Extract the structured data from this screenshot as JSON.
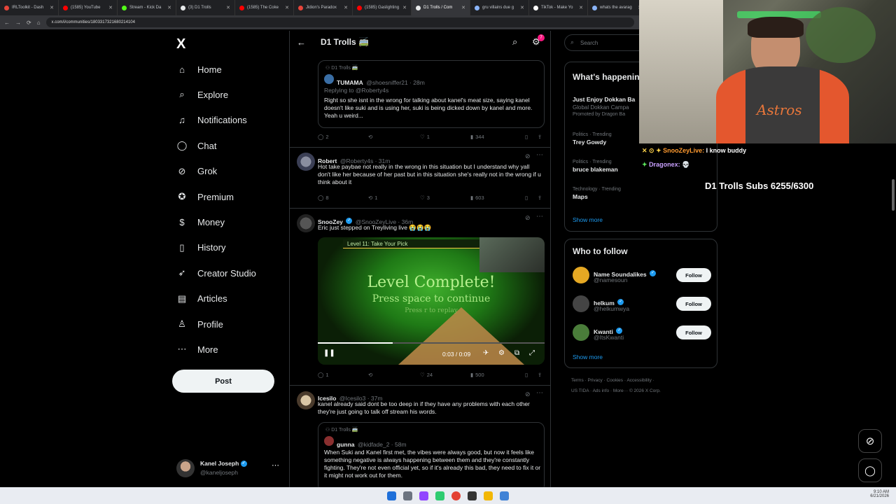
{
  "browser": {
    "tabs": [
      {
        "label": "IRLToolkit - Dash",
        "color": "#e6453a"
      },
      {
        "label": "(1585) YouTube",
        "color": "#ff0000"
      },
      {
        "label": "Stream - Kick Da",
        "color": "#53fc18"
      },
      {
        "label": "(3) D1 Trolls",
        "color": "#e7e9ea"
      },
      {
        "label": "(1585) The Coke",
        "color": "#ff0000"
      },
      {
        "label": "Jidion's Paradox",
        "color": "#e6453a"
      },
      {
        "label": "(1585) Gaslighting",
        "color": "#ff0000"
      },
      {
        "label": "D1 Trolls / Com",
        "color": "#e7e9ea",
        "active": true
      },
      {
        "label": "gru villains due g",
        "color": "#8ab4f8"
      },
      {
        "label": "TikTok - Make Yo",
        "color": "#ffffff"
      },
      {
        "label": "whats the avarag",
        "color": "#8ab4f8"
      }
    ],
    "url": "x.com/i/communities/1803317321680214104"
  },
  "nav": {
    "logo": "X",
    "items": [
      {
        "label": "Home",
        "icon": "home-icon",
        "glyph": "⌂"
      },
      {
        "label": "Explore",
        "icon": "search-icon",
        "glyph": "⌕"
      },
      {
        "label": "Notifications",
        "icon": "bell-icon",
        "glyph": "♫"
      },
      {
        "label": "Chat",
        "icon": "chat-icon",
        "glyph": "◯"
      },
      {
        "label": "Grok",
        "icon": "grok-icon",
        "glyph": "⊘"
      },
      {
        "label": "Premium",
        "icon": "premium-icon",
        "glyph": "✪"
      },
      {
        "label": "Money",
        "icon": "money-icon",
        "glyph": "$"
      },
      {
        "label": "History",
        "icon": "bookmark-icon",
        "glyph": "▯"
      },
      {
        "label": "Creator Studio",
        "icon": "rocket-icon",
        "glyph": "➶"
      },
      {
        "label": "Articles",
        "icon": "articles-icon",
        "glyph": "▤"
      },
      {
        "label": "Profile",
        "icon": "profile-icon",
        "glyph": "♙"
      },
      {
        "label": "More",
        "icon": "more-icon",
        "glyph": "⋯"
      }
    ],
    "post": "Post",
    "account": {
      "name": "Kanel Joseph",
      "handle": "@kaneljoseph"
    }
  },
  "header": {
    "title": "D1 Trolls 🚎",
    "badge": "7"
  },
  "feed": {
    "quote1": {
      "community": "D1 Trolls 🚎",
      "name": "TUMAMA",
      "meta": "@shoesniffer21 · 28m",
      "reply": "Replying to @Roberty4s",
      "text": "Right so she isnt in the wrong for talking about kanel's meat size, saying kanel doesn't like suki and is using her, suki is being dicked down by kanel and more. Yeah u weird..."
    },
    "actions1": {
      "replies": "2",
      "reposts": "",
      "likes": "1",
      "views": "344"
    },
    "post2": {
      "name": "Robert",
      "meta": "@Roberty4s · 31m",
      "text": "Hot take paybae not really in the wrong in this situation but I understand why yall don't like her because of her past but in this situation she's really not in the wrong if u think about it"
    },
    "actions2": {
      "replies": "8",
      "reposts": "1",
      "likes": "3",
      "views": "603"
    },
    "post3": {
      "name": "SnooZey",
      "meta": "@SnooZeyLive · 36m",
      "text": "Eric just stepped on Treyliving live 😭😭😭"
    },
    "video": {
      "level_bar": "Level 11: Take Your Pick",
      "complete": "Level Complete!",
      "press_space": "Press space to continue",
      "press_r": "Press r to replay",
      "time": "0:03 / 0:09"
    },
    "actions3": {
      "replies": "1",
      "reposts": "",
      "likes": "24",
      "views": "500"
    },
    "post4": {
      "name": "Icesilo",
      "meta": "@Icesilo3 · 37m",
      "text": "kanel already said dont be too deep in if they have any problems with each other they're just going to talk off stream his words."
    },
    "quote2": {
      "community": "D1 Trolls 🚎",
      "name": "gunna",
      "meta": "@kidfade_2 · 58m",
      "text": "When Suki and Kanel first met, the vibes were always good, but now it feels like something negative is always happening between them and they're constantly fighting. They're not even official yet, so if it's already this bad, they need to fix it or it might not work out for them."
    }
  },
  "right": {
    "search_placeholder": "Search",
    "happening_title": "What's happening",
    "ad": {
      "title": "Just Enjoy Dokkan Ba",
      "sub": "Global Dokkan Campa",
      "promo": "Promoted by Dragon Ba"
    },
    "trends": [
      {
        "cat": "Politics · Trending",
        "name": "Trey Gowdy"
      },
      {
        "cat": "Politics · Trending",
        "name": "bruce blakeman"
      },
      {
        "cat": "Technology · Trending",
        "name": "Maps"
      }
    ],
    "show_more": "Show more",
    "who_title": "Who to follow",
    "follow": [
      {
        "name": "Name Soundalikes",
        "handle": "@namesoun",
        "color": "#e5a823"
      },
      {
        "name": "helkum",
        "handle": "@helkumwya",
        "color": "#444"
      },
      {
        "name": "Kwanti",
        "handle": "@ItsKwanti",
        "color": "#4a7d3a"
      }
    ],
    "follow_label": "Follow",
    "footer1": "Terms · Privacy · Cookies · Accessibility ·",
    "footer2": "US TIDA · Ads info · More··· © 2026 X Corp."
  },
  "overlay": {
    "chat1_user": "SnooZeyLive:",
    "chat1_msg": "I know buddy",
    "chat2_user": "Dragonex:",
    "chat2_msg": "💀",
    "subs": "D1 Trolls Subs 6255/6300"
  },
  "system": {
    "time": "9:10 AM",
    "date": "6/21/2026"
  }
}
